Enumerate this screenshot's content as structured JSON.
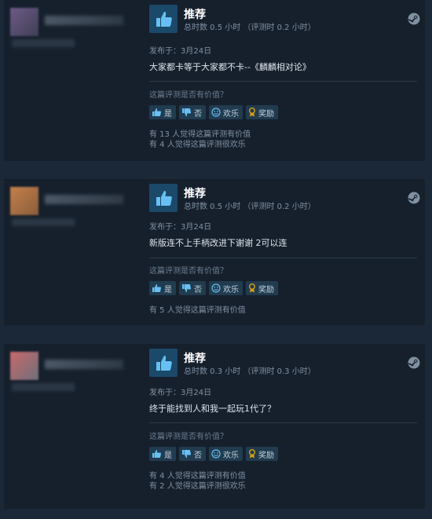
{
  "reviews": [
    {
      "rec_title": "推荐",
      "hours": "总时数 0.5 小时 （评测时 0.2 小时）",
      "posted": "发布于：3月24日",
      "text": "大家都卡等于大家都不卡--《麟麟相对论》",
      "helpful_q": "这篇评测是否有价值？",
      "yes": "是",
      "no": "否",
      "funny": "欢乐",
      "award": "奖励",
      "stat1": "有 13 人觉得这篇评测有价值",
      "stat2": "有 4 人觉得这篇评测很欢乐"
    },
    {
      "rec_title": "推荐",
      "hours": "总时数 0.5 小时 （评测时 0.2 小时）",
      "posted": "发布于：3月24日",
      "text": "新版连不上手柄改进下谢谢 2可以连",
      "helpful_q": "这篇评测是否有价值？",
      "yes": "是",
      "no": "否",
      "funny": "欢乐",
      "award": "奖励",
      "stat1": "有 5 人觉得这篇评测有价值",
      "stat2": ""
    },
    {
      "rec_title": "推荐",
      "hours": "总时数 0.3 小时 （评测时 0.3 小时）",
      "posted": "发布于：3月24日",
      "text": "终于能找到人和我一起玩1代了？",
      "helpful_q": "这篇评测是否有价值？",
      "yes": "是",
      "no": "否",
      "funny": "欢乐",
      "award": "奖励",
      "stat1": "有 4 人觉得这篇评测有价值",
      "stat2": "有 2 人觉得这篇评测很欢乐"
    }
  ],
  "colors": {
    "accent": "#66c0f4",
    "award": "#d4a017",
    "panel": "#16202d"
  },
  "icons": [
    "thumbs-up-icon",
    "thumbs-down-icon",
    "smiley-icon",
    "award-icon",
    "steam-icon"
  ]
}
